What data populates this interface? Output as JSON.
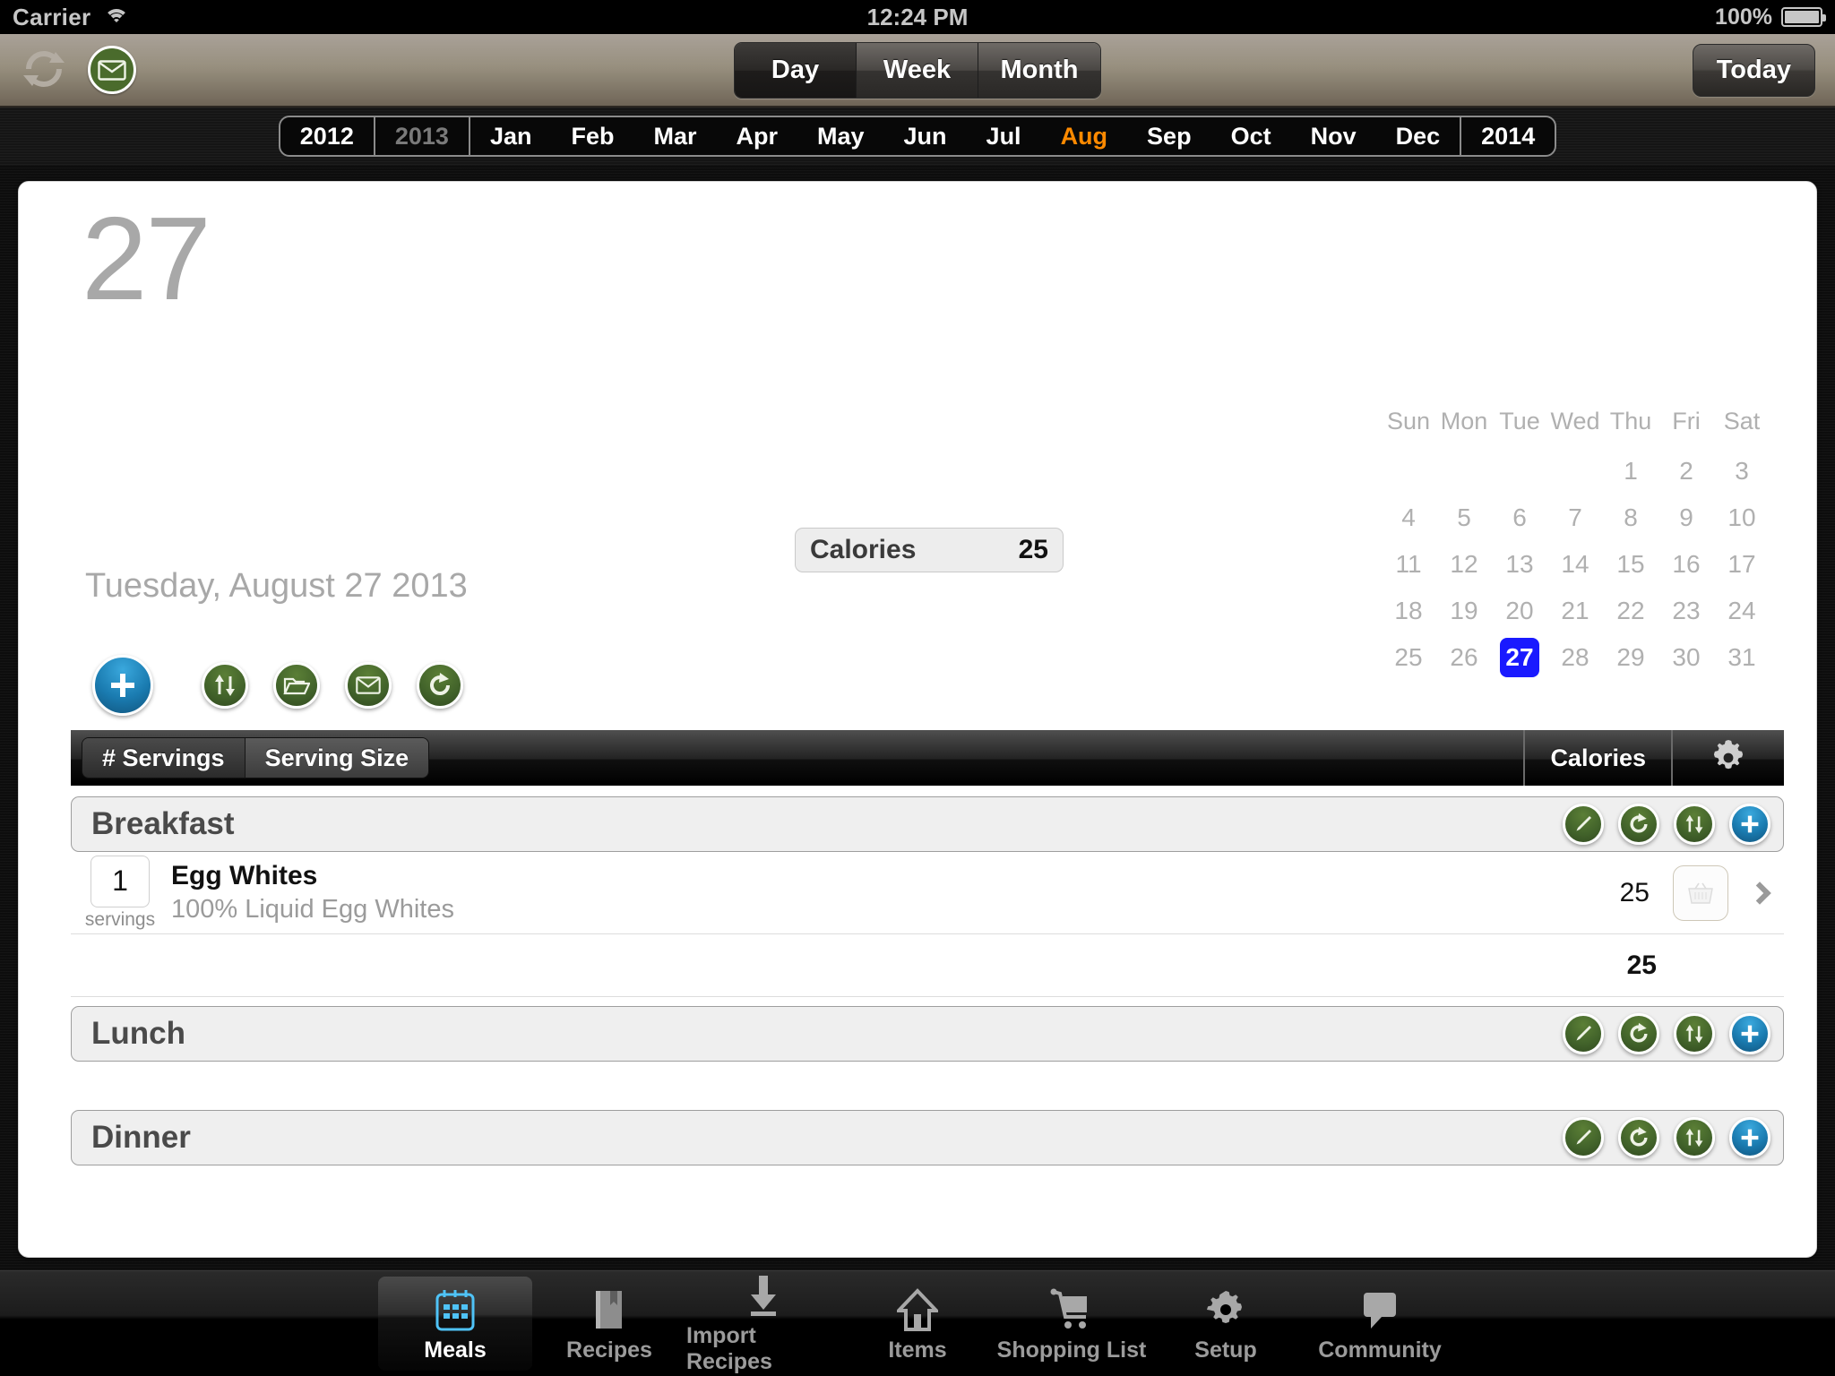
{
  "status_bar": {
    "carrier": "Carrier",
    "wifi_icon": "wifi-icon",
    "time": "12:24 PM",
    "battery_percent": "100%",
    "battery_icon": "battery-full-icon"
  },
  "toolbar": {
    "sync_icon": "sync-icon",
    "mail_icon": "mail-icon",
    "view_modes": [
      {
        "label": "Day",
        "selected": true
      },
      {
        "label": "Week",
        "selected": false
      },
      {
        "label": "Month",
        "selected": false
      }
    ],
    "today_label": "Today"
  },
  "month_bar": {
    "items": [
      {
        "label": "2012",
        "type": "year",
        "state": "normal"
      },
      {
        "label": "2013",
        "type": "year",
        "state": "dim"
      },
      {
        "label": "Jan",
        "type": "month",
        "state": "normal"
      },
      {
        "label": "Feb",
        "type": "month",
        "state": "normal"
      },
      {
        "label": "Mar",
        "type": "month",
        "state": "normal"
      },
      {
        "label": "Apr",
        "type": "month",
        "state": "normal"
      },
      {
        "label": "May",
        "type": "month",
        "state": "normal"
      },
      {
        "label": "Jun",
        "type": "month",
        "state": "normal"
      },
      {
        "label": "Jul",
        "type": "month",
        "state": "normal"
      },
      {
        "label": "Aug",
        "type": "month",
        "state": "selected"
      },
      {
        "label": "Sep",
        "type": "month",
        "state": "normal"
      },
      {
        "label": "Oct",
        "type": "month",
        "state": "normal"
      },
      {
        "label": "Nov",
        "type": "month",
        "state": "normal"
      },
      {
        "label": "Dec",
        "type": "month",
        "state": "normal"
      },
      {
        "label": "2014",
        "type": "year",
        "state": "normal"
      }
    ],
    "selected_month": "Aug",
    "selected_color": "#ff8a00"
  },
  "day_header": {
    "day_number": "27",
    "full_date": "Tuesday, August 27 2013",
    "calories_label": "Calories",
    "calories_value": "25",
    "actions": [
      {
        "name": "add-button",
        "icon": "plus-icon",
        "color": "#1a7bb0"
      },
      {
        "name": "sort-button",
        "icon": "sort-arrows-icon",
        "color": "#41622a"
      },
      {
        "name": "folder-button",
        "icon": "folder-icon",
        "color": "#41622a"
      },
      {
        "name": "email-button",
        "icon": "mail-icon",
        "color": "#41622a"
      },
      {
        "name": "repeat-button",
        "icon": "redo-arrow-icon",
        "color": "#41622a"
      }
    ]
  },
  "mini_calendar": {
    "weekday_labels": [
      "Sun",
      "Mon",
      "Tue",
      "Wed",
      "Thu",
      "Fri",
      "Sat"
    ],
    "leading_blanks": 4,
    "days": [
      1,
      2,
      3,
      4,
      5,
      6,
      7,
      8,
      9,
      10,
      11,
      12,
      13,
      14,
      15,
      16,
      17,
      18,
      19,
      20,
      21,
      22,
      23,
      24,
      25,
      26,
      27,
      28,
      29,
      30,
      31
    ],
    "selected_day": 27,
    "selected_color": "#1a1aff"
  },
  "table_header": {
    "segments": [
      {
        "label": "# Servings",
        "selected": true
      },
      {
        "label": "Serving Size",
        "selected": false
      }
    ],
    "calories_column": "Calories",
    "gear_icon": "gear-icon"
  },
  "sections": [
    {
      "title": "Breakfast",
      "buttons": [
        {
          "name": "edit-button",
          "icon": "pencil-icon"
        },
        {
          "name": "repeat-button",
          "icon": "redo-arrow-icon"
        },
        {
          "name": "sort-button",
          "icon": "sort-arrows-icon"
        },
        {
          "name": "add-button",
          "icon": "plus-icon"
        }
      ],
      "rows": [
        {
          "servings": "1",
          "servings_caption": "servings",
          "name": "Egg Whites",
          "description": "100% Liquid Egg Whites",
          "calories": "25",
          "basket_icon": "shopping-basket-icon",
          "chevron_icon": "chevron-right-icon"
        }
      ],
      "subtotal": "25"
    },
    {
      "title": "Lunch",
      "buttons": [
        {
          "name": "edit-button",
          "icon": "pencil-icon"
        },
        {
          "name": "repeat-button",
          "icon": "redo-arrow-icon"
        },
        {
          "name": "sort-button",
          "icon": "sort-arrows-icon"
        },
        {
          "name": "add-button",
          "icon": "plus-icon"
        }
      ],
      "rows": [],
      "subtotal": ""
    },
    {
      "title": "Dinner",
      "buttons": [
        {
          "name": "edit-button",
          "icon": "pencil-icon"
        },
        {
          "name": "repeat-button",
          "icon": "redo-arrow-icon"
        },
        {
          "name": "sort-button",
          "icon": "sort-arrows-icon"
        },
        {
          "name": "add-button",
          "icon": "plus-icon"
        }
      ],
      "rows": [],
      "subtotal": ""
    }
  ],
  "tab_bar": {
    "tabs": [
      {
        "label": "Meals",
        "icon": "calendar-icon",
        "selected": true
      },
      {
        "label": "Recipes",
        "icon": "book-icon",
        "selected": false
      },
      {
        "label": "Import Recipes",
        "icon": "download-icon",
        "selected": false
      },
      {
        "label": "Items",
        "icon": "house-icon",
        "selected": false
      },
      {
        "label": "Shopping List",
        "icon": "shopping-cart-icon",
        "selected": false
      },
      {
        "label": "Setup",
        "icon": "gear-icon",
        "selected": false
      },
      {
        "label": "Community",
        "icon": "speech-bubble-icon",
        "selected": false
      }
    ]
  }
}
